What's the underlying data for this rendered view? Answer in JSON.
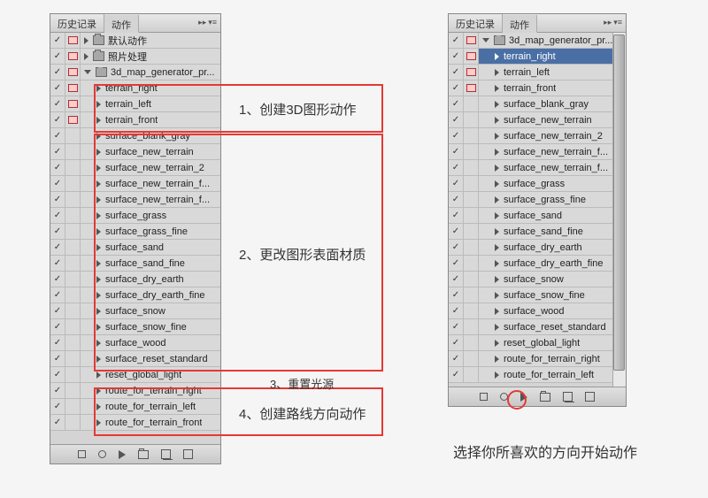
{
  "tabs": {
    "history": "历史记录",
    "actions": "动作"
  },
  "leftRows": [
    {
      "c": true,
      "d": "r",
      "exp": false,
      "depth": 0,
      "folder": true,
      "label": "默认动作"
    },
    {
      "c": true,
      "d": "r",
      "exp": false,
      "depth": 0,
      "folder": true,
      "label": "照片处理"
    },
    {
      "c": true,
      "d": "r",
      "exp": true,
      "depth": 0,
      "folder": true,
      "label": "3d_map_generator_pr..."
    },
    {
      "c": true,
      "d": "r",
      "exp": false,
      "depth": 1,
      "label": "terrain_right"
    },
    {
      "c": true,
      "d": "r",
      "exp": false,
      "depth": 1,
      "label": "terrain_left"
    },
    {
      "c": true,
      "d": "r",
      "exp": false,
      "depth": 1,
      "label": "terrain_front"
    },
    {
      "c": true,
      "d": "",
      "exp": false,
      "depth": 1,
      "label": "surface_blank_gray"
    },
    {
      "c": true,
      "d": "",
      "exp": false,
      "depth": 1,
      "label": "surface_new_terrain"
    },
    {
      "c": true,
      "d": "",
      "exp": false,
      "depth": 1,
      "label": "surface_new_terrain_2"
    },
    {
      "c": true,
      "d": "",
      "exp": false,
      "depth": 1,
      "label": "surface_new_terrain_f..."
    },
    {
      "c": true,
      "d": "",
      "exp": false,
      "depth": 1,
      "label": "surface_new_terrain_f..."
    },
    {
      "c": true,
      "d": "",
      "exp": false,
      "depth": 1,
      "label": "surface_grass"
    },
    {
      "c": true,
      "d": "",
      "exp": false,
      "depth": 1,
      "label": "surface_grass_fine"
    },
    {
      "c": true,
      "d": "",
      "exp": false,
      "depth": 1,
      "label": "surface_sand"
    },
    {
      "c": true,
      "d": "",
      "exp": false,
      "depth": 1,
      "label": "surface_sand_fine"
    },
    {
      "c": true,
      "d": "",
      "exp": false,
      "depth": 1,
      "label": "surface_dry_earth"
    },
    {
      "c": true,
      "d": "",
      "exp": false,
      "depth": 1,
      "label": "surface_dry_earth_fine"
    },
    {
      "c": true,
      "d": "",
      "exp": false,
      "depth": 1,
      "label": "surface_snow"
    },
    {
      "c": true,
      "d": "",
      "exp": false,
      "depth": 1,
      "label": "surface_snow_fine"
    },
    {
      "c": true,
      "d": "",
      "exp": false,
      "depth": 1,
      "label": "surface_wood"
    },
    {
      "c": true,
      "d": "",
      "exp": false,
      "depth": 1,
      "label": "surface_reset_standard"
    },
    {
      "c": true,
      "d": "",
      "exp": false,
      "depth": 1,
      "label": "reset_global_light"
    },
    {
      "c": true,
      "d": "",
      "exp": false,
      "depth": 1,
      "label": "route_for_terrain_right"
    },
    {
      "c": true,
      "d": "",
      "exp": false,
      "depth": 1,
      "label": "route_for_terrain_left"
    },
    {
      "c": true,
      "d": "",
      "exp": false,
      "depth": 1,
      "label": "route_for_terrain_front"
    }
  ],
  "rightRows": [
    {
      "c": true,
      "d": "r",
      "exp": true,
      "depth": 0,
      "folder": true,
      "label": "3d_map_generator_pr..."
    },
    {
      "c": true,
      "d": "r",
      "exp": false,
      "depth": 1,
      "sel": true,
      "label": "terrain_right"
    },
    {
      "c": true,
      "d": "r",
      "exp": false,
      "depth": 1,
      "label": "terrain_left"
    },
    {
      "c": true,
      "d": "r",
      "exp": false,
      "depth": 1,
      "label": "terrain_front"
    },
    {
      "c": true,
      "d": "",
      "exp": false,
      "depth": 1,
      "label": "surface_blank_gray"
    },
    {
      "c": true,
      "d": "",
      "exp": false,
      "depth": 1,
      "label": "surface_new_terrain"
    },
    {
      "c": true,
      "d": "",
      "exp": false,
      "depth": 1,
      "label": "surface_new_terrain_2"
    },
    {
      "c": true,
      "d": "",
      "exp": false,
      "depth": 1,
      "label": "surface_new_terrain_f..."
    },
    {
      "c": true,
      "d": "",
      "exp": false,
      "depth": 1,
      "label": "surface_new_terrain_f..."
    },
    {
      "c": true,
      "d": "",
      "exp": false,
      "depth": 1,
      "label": "surface_grass"
    },
    {
      "c": true,
      "d": "",
      "exp": false,
      "depth": 1,
      "label": "surface_grass_fine"
    },
    {
      "c": true,
      "d": "",
      "exp": false,
      "depth": 1,
      "label": "surface_sand"
    },
    {
      "c": true,
      "d": "",
      "exp": false,
      "depth": 1,
      "label": "surface_sand_fine"
    },
    {
      "c": true,
      "d": "",
      "exp": false,
      "depth": 1,
      "label": "surface_dry_earth"
    },
    {
      "c": true,
      "d": "",
      "exp": false,
      "depth": 1,
      "label": "surface_dry_earth_fine"
    },
    {
      "c": true,
      "d": "",
      "exp": false,
      "depth": 1,
      "label": "surface_snow"
    },
    {
      "c": true,
      "d": "",
      "exp": false,
      "depth": 1,
      "label": "surface_snow_fine"
    },
    {
      "c": true,
      "d": "",
      "exp": false,
      "depth": 1,
      "label": "surface_wood"
    },
    {
      "c": true,
      "d": "",
      "exp": false,
      "depth": 1,
      "label": "surface_reset_standard"
    },
    {
      "c": true,
      "d": "",
      "exp": false,
      "depth": 1,
      "label": "reset_global_light"
    },
    {
      "c": true,
      "d": "",
      "exp": false,
      "depth": 1,
      "label": "route_for_terrain_right"
    },
    {
      "c": true,
      "d": "",
      "exp": false,
      "depth": 1,
      "label": "route_for_terrain_left"
    }
  ],
  "notes": {
    "n1": "1、创建3D图形动作",
    "n2": "2、更改图形表面材质",
    "n3": "3、重置光源",
    "n4": "4、创建路线方向动作"
  },
  "caption": "选择你所喜欢的方向开始动作"
}
